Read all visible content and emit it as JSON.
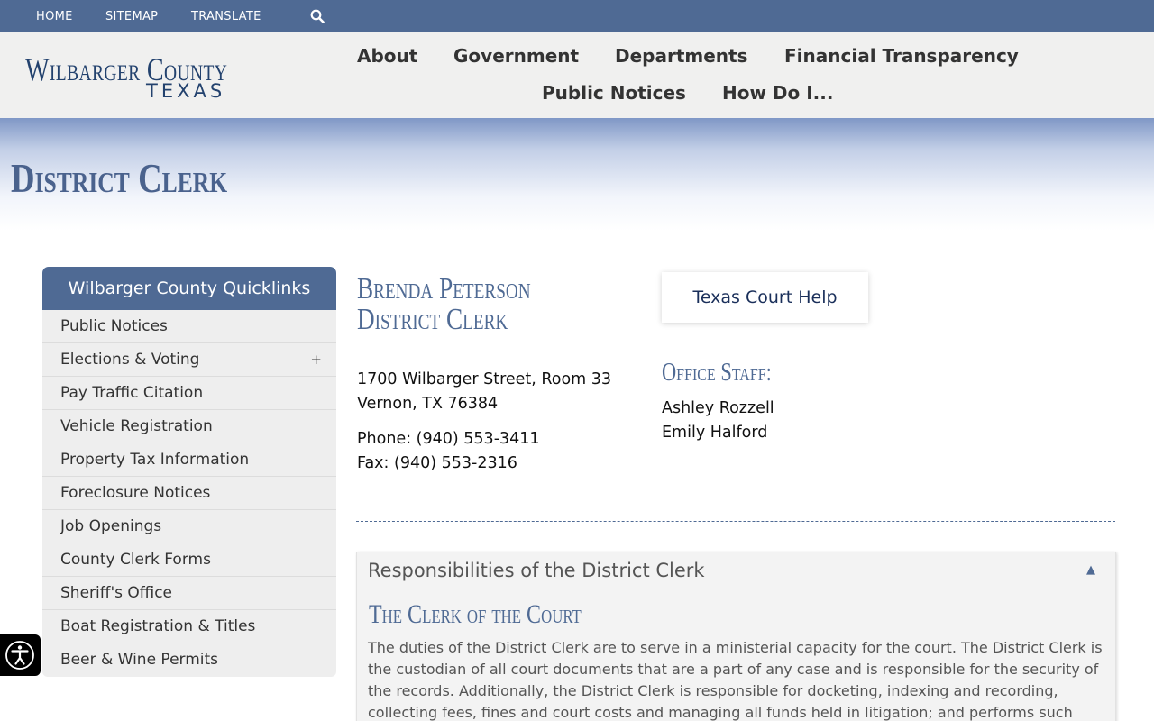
{
  "topbar": {
    "links": [
      "HOME",
      "SITEMAP",
      "TRANSLATE"
    ],
    "search_icon": "search-icon"
  },
  "logo": {
    "line1": "Wilbarger County",
    "line2": "TEXAS"
  },
  "nav": {
    "items": [
      "About",
      "Government",
      "Departments",
      "Financial Transparency",
      "Public Notices",
      "How Do I..."
    ]
  },
  "page": {
    "title": "District Clerk"
  },
  "sidebar": {
    "heading": "Wilbarger County Quicklinks",
    "items": [
      {
        "label": "Public Notices"
      },
      {
        "label": "Elections & Voting",
        "expand": "+"
      },
      {
        "label": "Pay Traffic Citation"
      },
      {
        "label": "Vehicle Registration"
      },
      {
        "label": "Property Tax Information"
      },
      {
        "label": "Foreclosure Notices"
      },
      {
        "label": "Job Openings"
      },
      {
        "label": "County Clerk Forms"
      },
      {
        "label": "Sheriff's Office"
      },
      {
        "label": "Boat Registration & Titles"
      },
      {
        "label": "Beer & Wine Permits"
      }
    ]
  },
  "contact": {
    "name": "Brenda Peterson",
    "role": "District Clerk",
    "address1": "1700 Wilbarger Street, Room 33",
    "address2": "Vernon, TX 76384",
    "phone": "Phone: (940) 553-3411",
    "fax": "Fax: (940) 553-2316"
  },
  "help_button": "Texas Court Help",
  "staff": {
    "title": "Office Staff:",
    "members": [
      "Ashley Rozzell",
      "Emily Halford"
    ]
  },
  "accordion": {
    "title": "Responsibilities of the District Clerk",
    "toggle": "▲",
    "subtitle": "The Clerk of the Court",
    "body": "The duties of the District Clerk are to serve in a ministerial capacity for the court. The District Clerk is the custodian of all court documents that are a part of any case and is responsible for the security of the records. Additionally, the District Clerk is responsible for docketing, indexing and recording, collecting fees, fines and court costs and managing all funds held in litigation; and performs such"
  },
  "colors": {
    "brand": "#4f6a94",
    "header_bg": "#f0f0ef",
    "sidebar_bg": "#eeeeee"
  },
  "accessibility": {
    "icon": "accessibility-icon"
  }
}
